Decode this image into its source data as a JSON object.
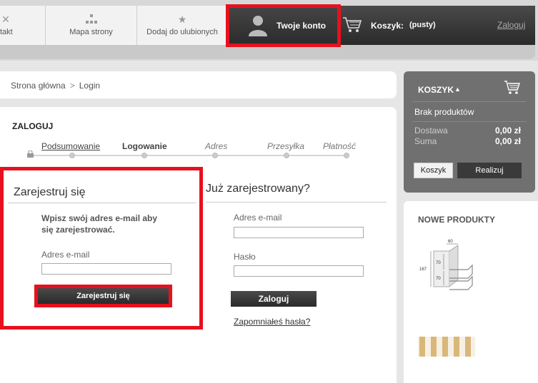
{
  "topnav": {
    "kontakt_label": "takt",
    "mapa_label": "Mapa strony",
    "dodaj_label": "Dodaj do ulubionych",
    "account_label": "Twoje konto",
    "cart_label": "Koszyk:",
    "cart_status": "(pusty)",
    "login_link": "Zaloguj"
  },
  "breadcrumb": {
    "home": "Strona główna",
    "separator": ">",
    "current": "Login"
  },
  "main": {
    "title": "ZALOGUJ",
    "steps": [
      {
        "label": "Podsumowanie",
        "state": "done"
      },
      {
        "label": "Logowanie",
        "state": "current"
      },
      {
        "label": "Adres",
        "state": "pending"
      },
      {
        "label": "Przesyłka",
        "state": "pending"
      },
      {
        "label": "Płatność",
        "state": "pending"
      }
    ]
  },
  "register": {
    "title": "Zarejestruj się",
    "description": "Wpisz swój adres e-mail aby się zarejestrować.",
    "email_label": "Adres e-mail",
    "email_value": "",
    "button": "Zarejestruj się"
  },
  "login": {
    "title": "Już zarejestrowany?",
    "email_label": "Adres e-mail",
    "email_value": "",
    "password_label": "Hasło",
    "password_value": "",
    "button": "Zaloguj",
    "forgot_link": "Zapomniałeś hasła?"
  },
  "cart_widget": {
    "title": "KOSZYK",
    "empty_text": "Brak produktów",
    "shipping_label": "Dostawa",
    "shipping_value": "0,00 zł",
    "total_label": "Suma",
    "total_value": "0,00 zł",
    "cart_button": "Koszyk",
    "checkout_button": "Realizuj"
  },
  "new_products": {
    "title": "NOWE PRODUKTY",
    "product1_dims": [
      "60",
      "167",
      "70",
      "70"
    ]
  },
  "colors": {
    "highlight": "#e8101e",
    "dark_button": "#2a2a2a",
    "cart_widget_bg": "#707070"
  }
}
